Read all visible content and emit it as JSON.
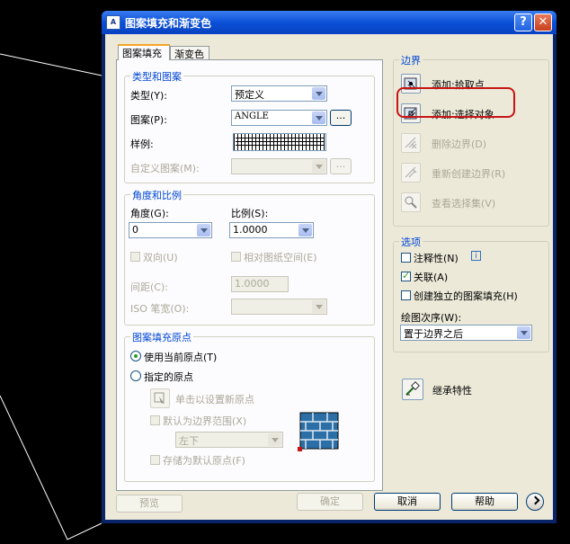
{
  "dialog": {
    "title": "图案填充和渐变色",
    "help_symbol": "?",
    "close_symbol": "✕"
  },
  "tabs": [
    "图案填充",
    "渐变色"
  ],
  "type_pattern": {
    "title": "类型和图案",
    "type_label": "类型(Y):",
    "type_value": "预定义",
    "pattern_label": "图案(P):",
    "pattern_value": "ANGLE",
    "browse_label": "...",
    "swatch_label": "样例:",
    "custom_label": "自定义图案(M):",
    "custom_value": ""
  },
  "angle_scale": {
    "title": "角度和比例",
    "angle_label": "角度(G):",
    "angle_value": "0",
    "scale_label": "比例(S):",
    "scale_value": "1.0000",
    "double_label": "双向(U)",
    "relative_label": "相对图纸空间(E)",
    "spacing_label": "间距(C):",
    "spacing_value": "1.0000",
    "iso_label": "ISO 笔宽(O):",
    "iso_value": ""
  },
  "origin": {
    "title": "图案填充原点",
    "use_current_label": "使用当前原点(T)",
    "use_current_checked": true,
    "specified_label": "指定的原点",
    "specified_checked": false,
    "click_set_label": "单击以设置新原点",
    "default_extent_label": "默认为边界范围(X)",
    "position_value": "左下",
    "store_default_label": "存储为默认原点(F)"
  },
  "boundary": {
    "title": "边界",
    "items": [
      {
        "label": "添加:拾取点",
        "icon": "pick-points-icon",
        "enabled": true
      },
      {
        "label": "添加:选择对象",
        "icon": "select-objects-icon",
        "enabled": true
      },
      {
        "label": "删除边界(D)",
        "icon": "remove-boundary-icon",
        "enabled": false
      },
      {
        "label": "重新创建边界(R)",
        "icon": "recreate-boundary-icon",
        "enabled": false
      },
      {
        "label": "查看选择集(V)",
        "icon": "view-selection-icon",
        "enabled": false
      }
    ]
  },
  "options": {
    "title": "选项",
    "annotative_label": "注释性(N)",
    "annotative_checked": false,
    "info_symbol": "i",
    "associative_label": "关联(A)",
    "associative_checked": true,
    "separate_label": "创建独立的图案填充(H)",
    "separate_checked": false,
    "draw_order_label": "绘图次序(W):",
    "draw_order_value": "置于边界之后"
  },
  "inherit_label": "继承特性",
  "footer": {
    "preview_label": "预览",
    "ok_label": "确定",
    "cancel_label": "取消",
    "help_label": "帮助"
  },
  "colors": {
    "titlebar": "#0b50d8",
    "dialog_bg": "#ece9d8",
    "group_title": "#0046d5",
    "highlight_ring": "#c81414"
  }
}
